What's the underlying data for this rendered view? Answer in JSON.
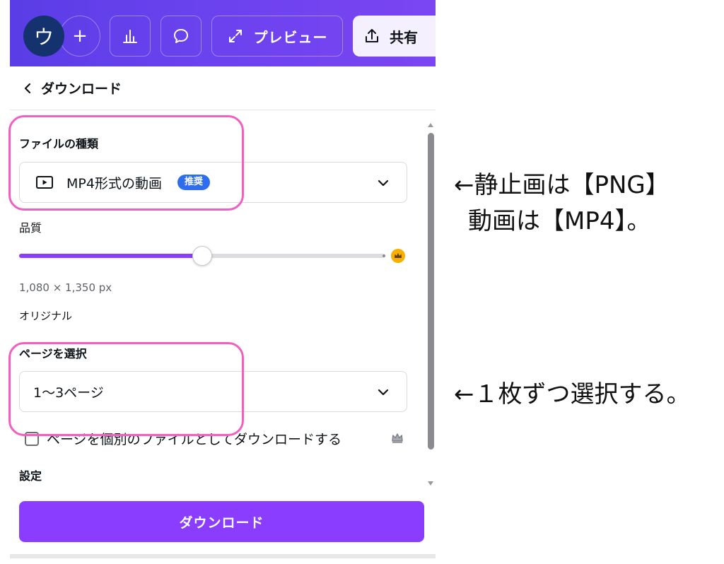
{
  "topbar": {
    "avatar_initial": "ウ",
    "add_label": "+",
    "preview_label": "プレビュー",
    "share_label": "共有"
  },
  "panel": {
    "title": "ダウンロード",
    "file_type": {
      "label": "ファイルの種類",
      "value": "MP4形式の動画",
      "badge": "推奨"
    },
    "quality": {
      "label": "品質",
      "level_fraction": 0.5,
      "dimensions": "1,080 × 1,350 px",
      "note": "オリジナル"
    },
    "pages": {
      "label": "ページを選択",
      "value": "1〜3ページ"
    },
    "separate_files_label": "ページを個別のファイルとしてダウンロードする",
    "settings_label": "設定",
    "download_button": "ダウンロード"
  },
  "annotations": {
    "line1": "←静止画は【PNG】",
    "line2": "動画は【MP4】。",
    "line3": "←１枚ずつ選択する。"
  },
  "colors": {
    "accent": "#8b3dff",
    "highlight": "#f25fc3",
    "badge": "#2f6df0",
    "premium": "#f5b000"
  }
}
